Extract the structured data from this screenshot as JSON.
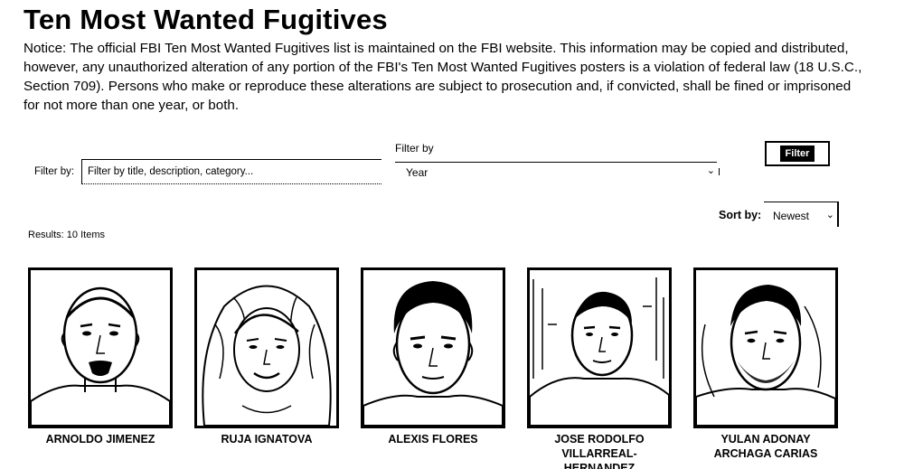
{
  "page": {
    "title": "Ten Most Wanted Fugitives",
    "notice": "Notice: The official FBI Ten Most Wanted Fugitives list is maintained on the FBI website. This information may be copied and distributed, however, any unauthorized alteration of any portion of the FBI's Ten Most Wanted Fugitives posters is a violation of federal law (18 U.S.C., Section 709). Persons who make or reproduce these alterations are subject to prosecution and, if convicted, shall be fined or imprisoned for not more than one year, or both."
  },
  "filters": {
    "text_label": "Filter by:",
    "text_placeholder": "Filter by title, description, category...",
    "year_caption": "Filter by",
    "year_value": "Year",
    "button_label": "Filter",
    "sort_label": "Sort by:",
    "sort_value": "Newest"
  },
  "results": {
    "count_text": "Results: 10 Items"
  },
  "fugitives": [
    {
      "name": "ARNOLDO JIMENEZ"
    },
    {
      "name": "RUJA IGNATOVA"
    },
    {
      "name": "ALEXIS FLORES"
    },
    {
      "name": "JOSE RODOLFO\nVILLARREAL-HERNANDEZ"
    },
    {
      "name": "YULAN ADONAY\nARCHAGA CARIAS"
    }
  ],
  "icons": {
    "select_chevron": "chevron-down-icon"
  }
}
